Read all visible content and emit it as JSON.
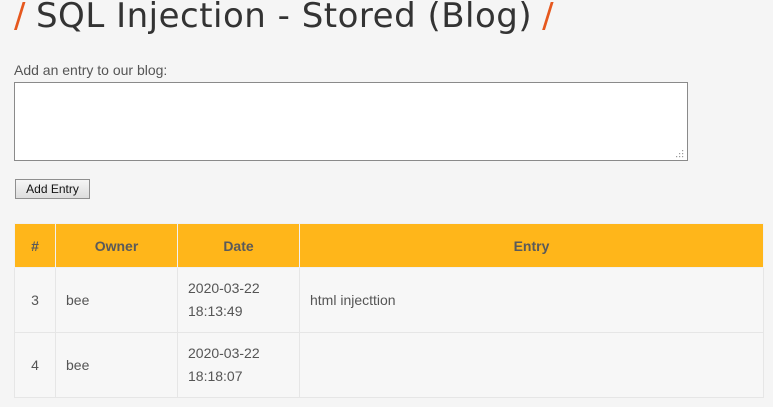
{
  "page": {
    "slash_left": "/",
    "title": "SQL Injection - Stored (Blog)",
    "slash_right": "/"
  },
  "form": {
    "prompt": "Add an entry to our blog:",
    "entry_value": "",
    "add_button": "Add Entry"
  },
  "table": {
    "headers": {
      "num": "#",
      "owner": "Owner",
      "date": "Date",
      "entry": "Entry"
    },
    "rows": [
      {
        "num": "3",
        "owner": "bee",
        "date": "2020-03-22",
        "time": "18:13:49",
        "entry": "html injecttion"
      },
      {
        "num": "4",
        "owner": "bee",
        "date": "2020-03-22",
        "time": "18:18:07",
        "entry": ""
      }
    ]
  },
  "colors": {
    "header_bg": "#ffb61a",
    "accent_slash": "#e6581e"
  }
}
